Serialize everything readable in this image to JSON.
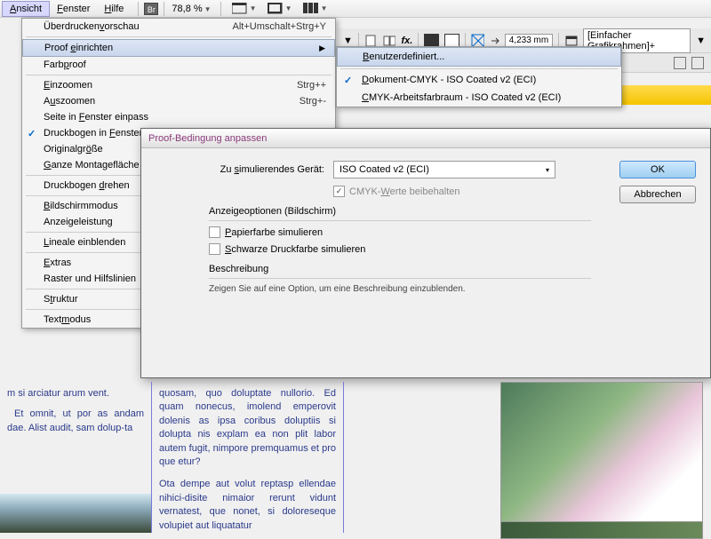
{
  "menubar": {
    "items": [
      {
        "label": "Ansicht",
        "u": 0
      },
      {
        "label": "Fenster",
        "u": 0
      },
      {
        "label": "Hilfe",
        "u": 0
      }
    ],
    "zoom": "78,8 %"
  },
  "toolbar": {
    "measure": "4,233 mm",
    "preset": "[Einfacher Grafikrahmen]+"
  },
  "view_menu": {
    "items": [
      {
        "label": "Überdruckenvorschau",
        "u": 11,
        "shortcut": "Alt+Umschalt+Strg+Y"
      },
      {
        "sep": true
      },
      {
        "label": "Proof einrichten",
        "u": 6,
        "arrow": true,
        "hl": true
      },
      {
        "label": "Farbproof",
        "u": 4
      },
      {
        "sep": true
      },
      {
        "label": "Einzoomen",
        "u": 0,
        "shortcut": "Strg++"
      },
      {
        "label": "Auszoomen",
        "u": 1,
        "shortcut": "Strg+-"
      },
      {
        "label": "Seite in Fenster einpass",
        "u": 9
      },
      {
        "label": "Druckbogen in Fenster",
        "u": 14,
        "check": true
      },
      {
        "label": "Originalgröße",
        "u": 10
      },
      {
        "label": "Ganze Montagefläche",
        "u": 0
      },
      {
        "sep": true
      },
      {
        "label": "Druckbogen drehen",
        "u": 11
      },
      {
        "sep": true
      },
      {
        "label": "Bildschirmmodus",
        "u": 0
      },
      {
        "label": "Anzeigeleistung"
      },
      {
        "sep": true
      },
      {
        "label": "Lineale einblenden",
        "u": 0
      },
      {
        "sep": true
      },
      {
        "label": "Extras",
        "u": 0
      },
      {
        "label": "Raster und Hilfslinien"
      },
      {
        "sep": true
      },
      {
        "label": "Struktur",
        "u": 1
      },
      {
        "sep": true
      },
      {
        "label": "Textmodus",
        "u": 4,
        "arrow": true
      }
    ]
  },
  "submenu": {
    "items": [
      {
        "label": "Benutzerdefiniert...",
        "u": 0,
        "hl": true
      },
      {
        "sep": true
      },
      {
        "label": "Dokument-CMYK - ISO Coated v2 (ECI)",
        "u": 0,
        "check": true
      },
      {
        "label": "CMYK-Arbeitsfarbraum - ISO Coated v2 (ECI)",
        "u": 0
      }
    ]
  },
  "dialog": {
    "title": "Proof-Bedingung anpassen",
    "device_label": "Zu simulierendes Gerät:",
    "device_value": "ISO Coated v2 (ECI)",
    "preserve_cmyk": "CMYK-Werte beibehalten",
    "group1_title": "Anzeigeoptionen (Bildschirm)",
    "sim_paper": "Papierfarbe simulieren",
    "sim_black": "Schwarze Druckfarbe simulieren",
    "group2_title": "Beschreibung",
    "desc_text": "Zeigen Sie auf eine Option, um eine Beschreibung einzublenden.",
    "ok": "OK",
    "cancel": "Abbrechen"
  },
  "document": {
    "col1_a": "m si arciatur arum vent.",
    "col1_b": "Et omnit, ut por as andam dae. Alist audit, sam dolup-ta",
    "col2_a": "quosam, quo doluptate nullorio. Ed quam nonecus, imolend emperovit dolenis as ipsa coribus doluptiis si dolupta nis explam ea non plit labor autem fugit, nimpore premquamus et pro que etur?",
    "col2_b": "Ota dempe aut volut reptasp ellendae nihici-disite nimaior rerunt vidunt vernatest, que nonet, si doloreseque volupiet aut liquatatur"
  }
}
